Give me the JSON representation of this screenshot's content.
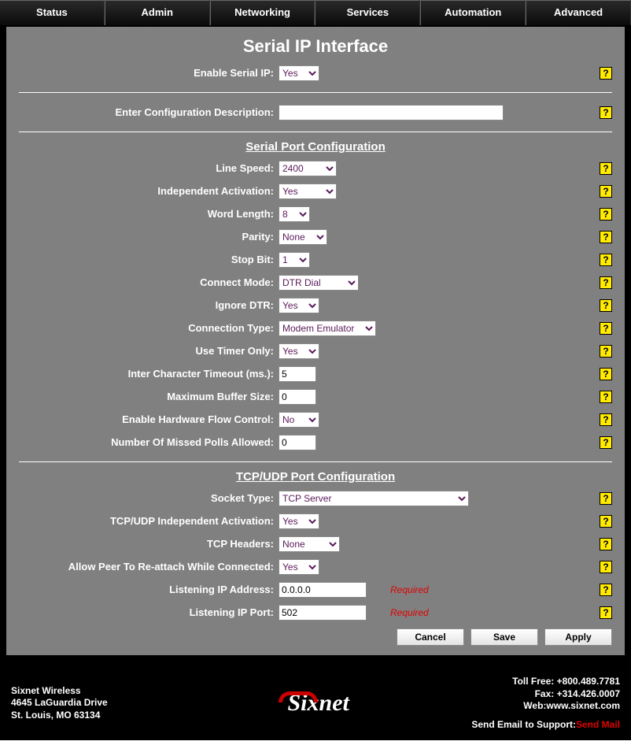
{
  "nav": [
    "Status",
    "Admin",
    "Networking",
    "Services",
    "Automation",
    "Advanced"
  ],
  "page_title": "Serial IP Interface",
  "enable_serial_ip": {
    "label": "Enable Serial IP:",
    "value": "Yes"
  },
  "config_desc": {
    "label": "Enter Configuration Description:",
    "value": ""
  },
  "section1": "Serial Port Configuration",
  "line_speed": {
    "label": "Line Speed:",
    "value": "2400"
  },
  "independent_activation": {
    "label": "Independent Activation:",
    "value": "Yes"
  },
  "word_length": {
    "label": "Word Length:",
    "value": "8"
  },
  "parity": {
    "label": "Parity:",
    "value": "None"
  },
  "stop_bit": {
    "label": "Stop Bit:",
    "value": "1"
  },
  "connect_mode": {
    "label": "Connect Mode:",
    "value": "DTR Dial"
  },
  "ignore_dtr": {
    "label": "Ignore DTR:",
    "value": "Yes"
  },
  "connection_type": {
    "label": "Connection Type:",
    "value": "Modem Emulator"
  },
  "use_timer_only": {
    "label": "Use Timer Only:",
    "value": "Yes"
  },
  "inter_char_timeout": {
    "label": "Inter Character Timeout (ms.):",
    "value": "5"
  },
  "max_buffer_size": {
    "label": "Maximum Buffer Size:",
    "value": "0"
  },
  "hw_flow_control": {
    "label": "Enable Hardware Flow Control:",
    "value": "No"
  },
  "missed_polls": {
    "label": "Number Of Missed Polls Allowed:",
    "value": "0"
  },
  "section2": "TCP/UDP Port Configuration",
  "socket_type": {
    "label": "Socket Type:",
    "value": "TCP Server"
  },
  "tcp_udp_ind_act": {
    "label": "TCP/UDP Independent Activation:",
    "value": "Yes"
  },
  "tcp_headers": {
    "label": "TCP Headers:",
    "value": "None"
  },
  "allow_peer_reattach": {
    "label": "Allow Peer To Re-attach While Connected:",
    "value": "Yes"
  },
  "listening_ip": {
    "label": "Listening IP Address:",
    "value": "0.0.0.0",
    "required": "Required"
  },
  "listening_port": {
    "label": "Listening IP Port:",
    "value": "502",
    "required": "Required"
  },
  "buttons": {
    "cancel": "Cancel",
    "save": "Save",
    "apply": "Apply"
  },
  "footer": {
    "company": "Sixnet Wireless",
    "address1": "4645 LaGuardia Drive",
    "address2": "St. Louis, MO 63134",
    "logo": "Sixnet",
    "tollfree": "Toll Free: +800.489.7781",
    "fax": "Fax: +314.426.0007",
    "web_label": "Web:",
    "web": "www.sixnet.com",
    "support": "Send Email to Support:",
    "mail": "Send Mail"
  },
  "help_glyph": "?"
}
